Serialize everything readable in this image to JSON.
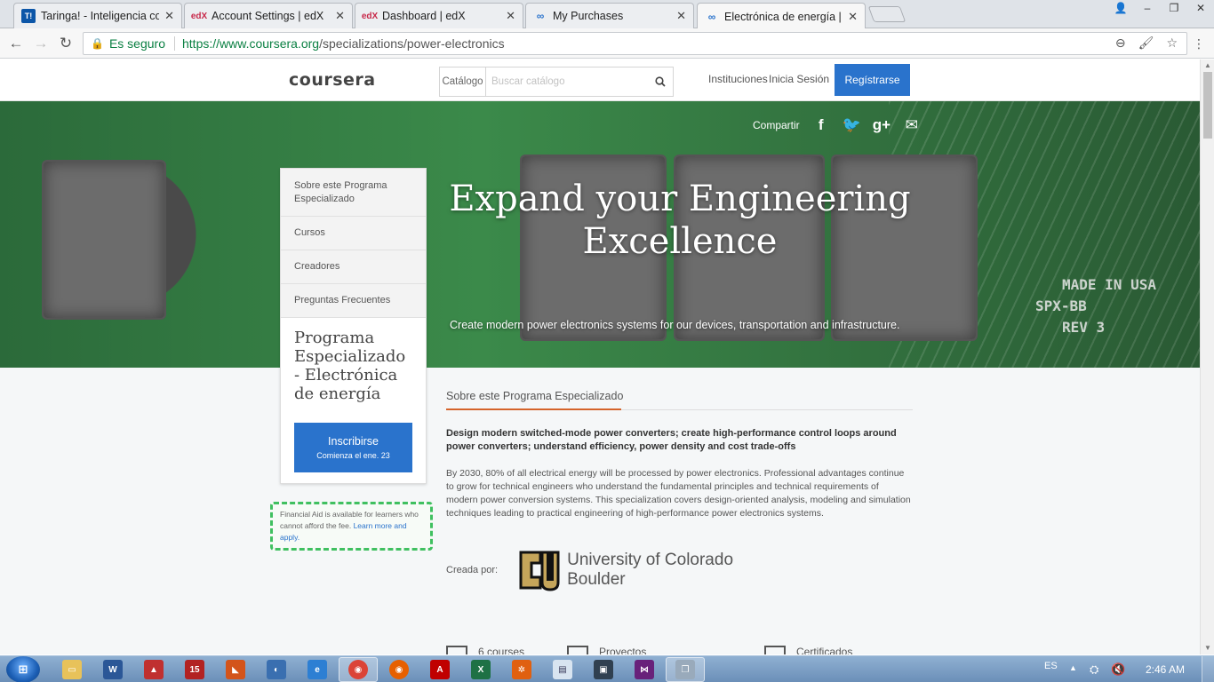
{
  "browser": {
    "tabs": [
      {
        "label": "Taringa! - Inteligencia co",
        "favicon": "T!"
      },
      {
        "label": "Account Settings | edX",
        "favicon": "edX"
      },
      {
        "label": "Dashboard | edX",
        "favicon": "edX"
      },
      {
        "label": "My Purchases",
        "favicon": "co"
      },
      {
        "label": "Electrónica de energía | C",
        "favicon": "co",
        "active": true
      }
    ],
    "secure_label": "Es seguro",
    "url_host": "https://www.coursera.org",
    "url_path": "/specializations/power-electronics"
  },
  "header": {
    "logo": "coursera",
    "catalog_label": "Catálogo",
    "search_placeholder": "Buscar catálogo",
    "institutions": "Instituciones",
    "login": "Inicia Sesión",
    "register": "Regístrarse"
  },
  "hero": {
    "share_label": "Compartir",
    "title": "Expand your Engineering Excellence",
    "subtitle": "Create modern power electronics systems for our devices, transportation and infrastructure.",
    "chip_marks": [
      "MADE IN USA",
      "SPX-BB",
      "REV 3"
    ]
  },
  "sidenav": {
    "items": [
      "Sobre este Programa Especializado",
      "Cursos",
      "Creadores",
      "Preguntas Frecuentes"
    ],
    "program_name": "Programa Especializado - Electrónica de energía",
    "enroll_label": "Inscribirse",
    "enroll_sub": "Comienza el ene. 23"
  },
  "financial_aid": {
    "text": "Financial Aid is available for learners who cannot afford the fee.",
    "link": "Learn more and apply."
  },
  "about": {
    "section_title": "Sobre este Programa Especializado",
    "lead": "Design modern switched-mode power converters; create high-performance control loops around power converters; understand efficiency, power density and cost trade-offs",
    "body": "By 2030, 80% of all electrical energy will be processed by power electronics. Professional advantages continue to grow for technical engineers who understand the fundamental principles and technical requirements of modern power conversion systems. This specialization covers design-oriented analysis, modeling and simulation techniques leading to practical engineering of high-performance power electronics systems.",
    "created_by_label": "Creada por:",
    "university": "University of Colorado Boulder"
  },
  "stats": [
    "6 courses",
    "Proyectos",
    "Certificados"
  ],
  "taskbar": {
    "lang": "ES",
    "time": "2:46 AM"
  },
  "colors": {
    "accent": "#2a73cc",
    "section_underline": "#d5642b",
    "aid_border": "#40c060",
    "secure_green": "#0b8043"
  }
}
